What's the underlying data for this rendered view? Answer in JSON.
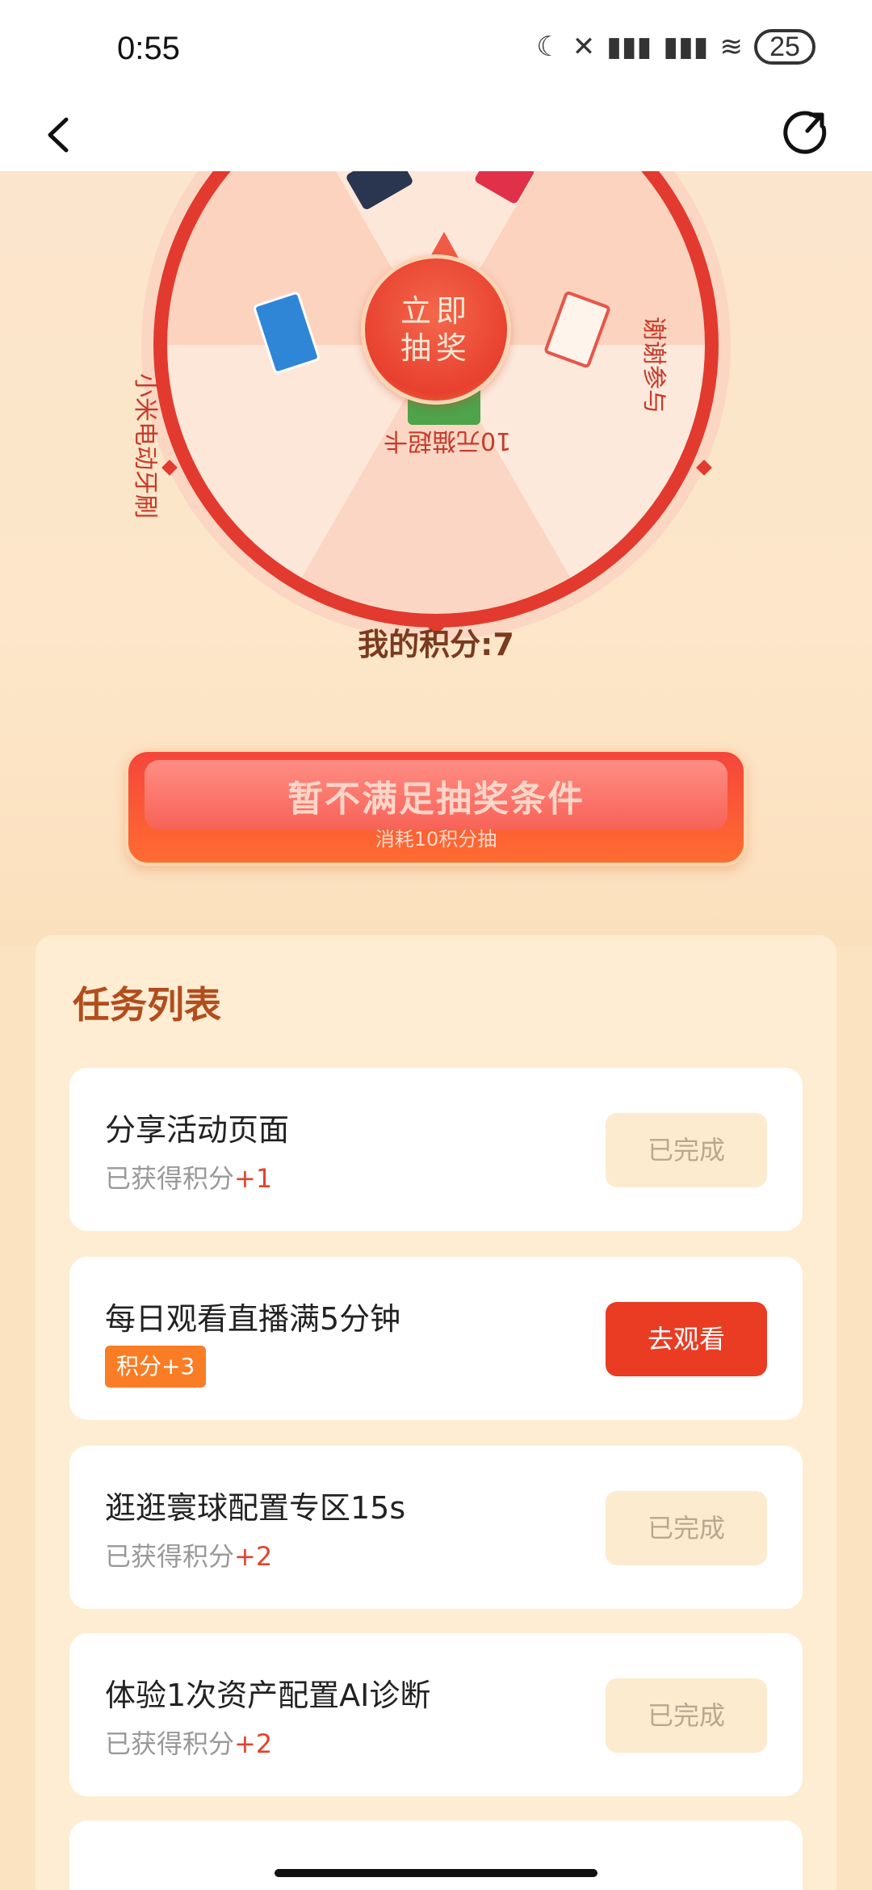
{
  "status_bar": {
    "time": "0:55",
    "battery_level": "25",
    "icons": [
      "moon-icon",
      "no-sim-icon",
      "signal-icon",
      "hd-signal-icon",
      "wifi-icon",
      "battery-icon"
    ]
  },
  "header": {
    "back_icon": "chevron-left-icon",
    "share_icon": "share-icon"
  },
  "wheel": {
    "center_line1": "立即",
    "center_line2": "抽奖",
    "prizes": [
      {
        "label": "小米电动牙刷"
      },
      {
        "label": "谢谢参与"
      },
      {
        "label": "10元猫超卡"
      }
    ]
  },
  "points": {
    "label": "我的积分:7"
  },
  "draw_button": {
    "title": "暂不满足抽奖条件",
    "subtitle": "消耗10积分抽"
  },
  "tasks": {
    "title": "任务列表",
    "items": [
      {
        "name": "分享活动页面",
        "reward_prefix": "已获得积分",
        "reward_value": "+1",
        "button": "已完成"
      },
      {
        "name": "每日观看直播满5分钟",
        "badge": "积分+3",
        "button": "去观看"
      },
      {
        "name": "逛逛寰球配置专区15s",
        "reward_prefix": "已获得积分",
        "reward_value": "+2",
        "button": "已完成"
      },
      {
        "name": "体验1次资产配置AI诊断",
        "reward_prefix": "已获得积分",
        "reward_value": "+2",
        "button": "已完成"
      }
    ]
  },
  "colors": {
    "accent_red": "#ea3b23",
    "wheel_red": "#e23a2e",
    "points_brown": "#7a3a1e",
    "task_title": "#b24d1d",
    "background": "#fbe3c2"
  }
}
